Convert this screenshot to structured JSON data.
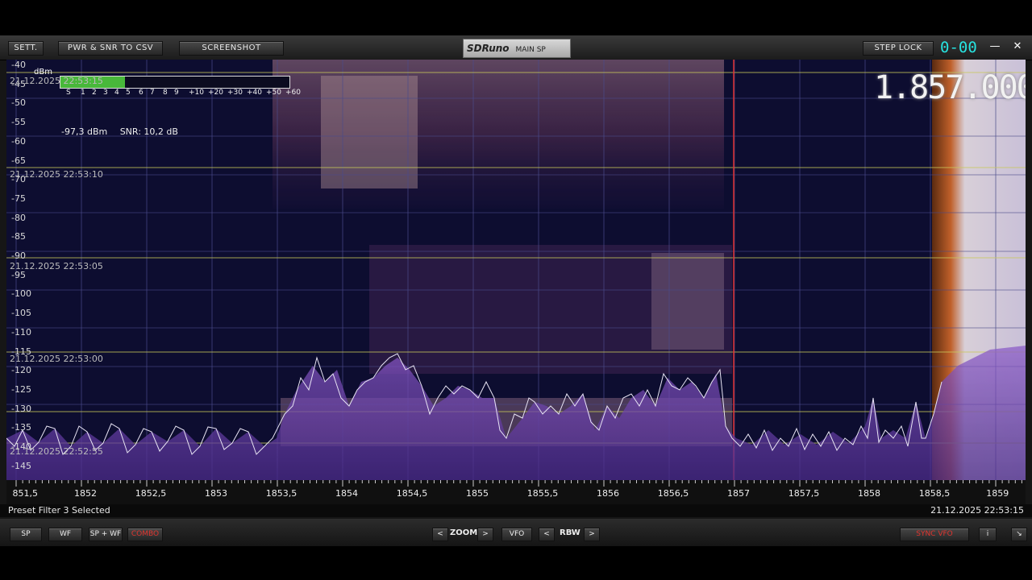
{
  "titlebar": {
    "sett_label": "SETT.",
    "csv_label": "PWR & SNR TO CSV",
    "screenshot_label": "SCREENSHOT",
    "brand": "SDRuno",
    "panel": "MAIN SP",
    "steplock_label": "STEP LOCK",
    "step_counter": "0-00",
    "minimize_glyph": "—",
    "close_glyph": "✕"
  },
  "smeter": {
    "unit": "dBm",
    "level_fraction": 0.28,
    "fill_color": "#48b83a",
    "scale": [
      "S",
      "1",
      "2",
      "3",
      "4",
      "5",
      "6",
      "7",
      "8",
      "9",
      "+10",
      "+20",
      "+30",
      "+40",
      "+50",
      "+60"
    ]
  },
  "readout": {
    "power": "-97,3 dBm",
    "snr": "SNR: 10,2 dB"
  },
  "frequency": "1.857.000",
  "yaxis": [
    "-40",
    "-45",
    "-50",
    "-55",
    "-60",
    "-65",
    "-70",
    "-75",
    "-80",
    "-85",
    "-90",
    "-95",
    "-100",
    "-105",
    "-110",
    "-115",
    "-120",
    "-125",
    "-130",
    "-135",
    "-140",
    "-145"
  ],
  "timestamps": [
    "21.12.2025 22:53:15",
    "21.12.2025 22:53:10",
    "21.12.2025 22:53:05",
    "21.12.2025 22:53:00",
    "21.12.2025 22:52:55"
  ],
  "xaxis": [
    "851,5",
    "1852",
    "1852,5",
    "1853",
    "1853,5",
    "1854",
    "1854,5",
    "1855",
    "1855,5",
    "1856",
    "1856,5",
    "1857",
    "1857,5",
    "1858",
    "1858,5",
    "1859"
  ],
  "status": {
    "left": "Preset Filter 3 Selected",
    "right": "21.12.2025 22:53:15"
  },
  "bottombar": {
    "sp_label": "SP",
    "wf_label": "WF",
    "spwf_label": "SP + WF",
    "combo_label": "COMBO",
    "zoom_prev": "<",
    "zoom_label": "ZOOM",
    "zoom_next": ">",
    "vfo_label": "VFO",
    "rbw_prev": "<",
    "rbw_label": "RBW",
    "rbw_next": ">",
    "sync_label": "SYNC VFO",
    "info_label": "i",
    "resize_glyph": "↘"
  },
  "colors": {
    "accent_cyan": "#27e3e0",
    "marker_red": "#e03030",
    "grid_yellow": "#c8c85a",
    "spectrum_fill": "#6b3fa8"
  }
}
